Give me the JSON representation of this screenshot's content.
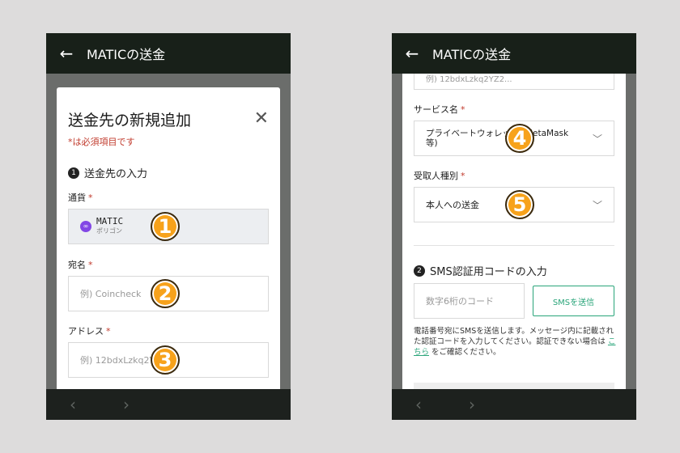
{
  "left": {
    "appbar": {
      "back_icon": "←",
      "title": "MATICの送金"
    },
    "modal": {
      "title": "送金先の新規追加",
      "close_icon": "✕",
      "required_note": "*は必須項目です",
      "step1": {
        "num": "1",
        "label": "送金先の入力"
      },
      "currency": {
        "label": "通貨",
        "star": "*",
        "symbol": "MATIC",
        "name": "ポリゴン",
        "icon_color": "#8247e5"
      },
      "recipient": {
        "label": "宛名",
        "star": "*",
        "placeholder": "例) Coincheck"
      },
      "address": {
        "label": "アドレス",
        "star": "*",
        "placeholder": "例) 12bdxLzkq2Y"
      }
    },
    "markers": [
      "1",
      "2",
      "3"
    ],
    "nav": {
      "prev": "‹",
      "next": "›"
    }
  },
  "right": {
    "appbar": {
      "back_icon": "←",
      "title": "MATICの送金"
    },
    "address_partial": "例) 12bdxLzkq2YZ2...",
    "service": {
      "label": "サービス名",
      "star": "*",
      "value_line1": "プライベートウォレット (MetaMask",
      "value_line2": "等)"
    },
    "recipient_type": {
      "label": "受取人種別",
      "star": "*",
      "value": "本人への送金"
    },
    "step2": {
      "num": "2",
      "label": "SMS認証用コードの入力"
    },
    "code_input": {
      "placeholder": "数字6桁のコード"
    },
    "sms_button": "SMSを送信",
    "note": {
      "text1": "電話番号宛にSMSを送信します。メッセージ内に記載された認証コードを入力してください。認証できない場合は ",
      "link": "こちら",
      "text2": " をご確認ください。"
    },
    "markers": [
      "4",
      "5"
    ],
    "nav": {
      "prev": "‹",
      "next": "›"
    }
  },
  "colors": {
    "accent": "#2aa57a",
    "required": "#c0392b",
    "marker": "#f7a21b",
    "appbar": "#182019"
  }
}
